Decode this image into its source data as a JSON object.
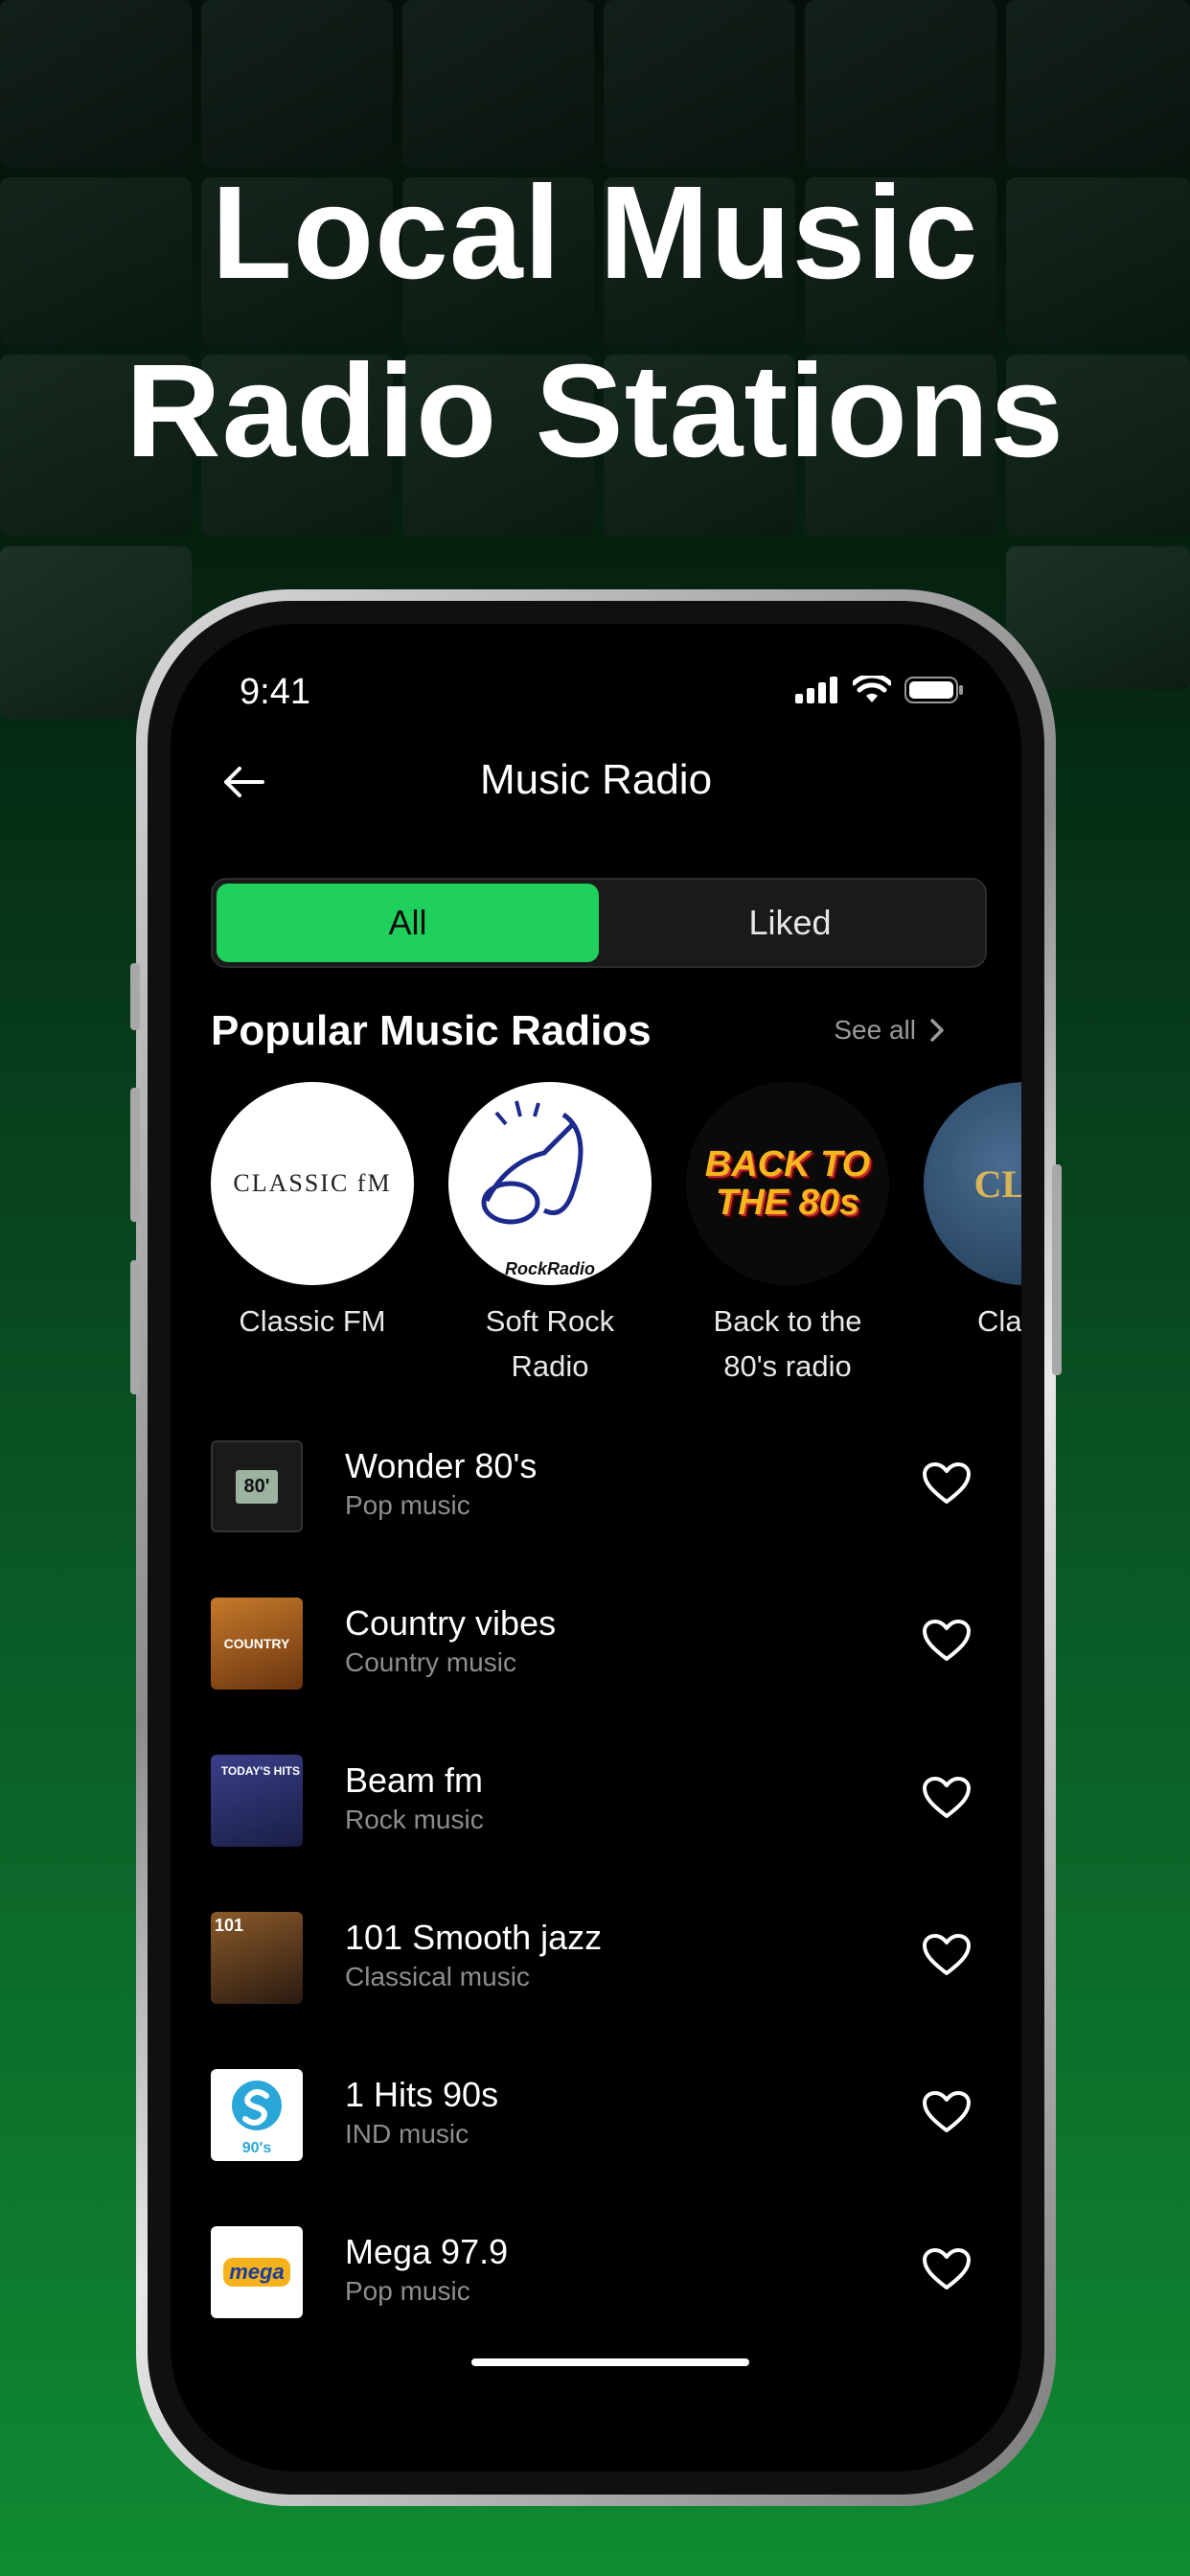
{
  "headline": {
    "line1": "Local Music",
    "line2": "Radio Stations"
  },
  "status": {
    "time": "9:41"
  },
  "nav": {
    "title": "Music Radio"
  },
  "tabs": [
    {
      "label": "All",
      "active": true
    },
    {
      "label": "Liked",
      "active": false
    }
  ],
  "popular": {
    "title": "Popular Music Radios",
    "see_all": "See all",
    "items": [
      {
        "label": "Classic FM",
        "logo_text": "CLASSIC fM"
      },
      {
        "label": "Soft Rock Radio",
        "logo_text": "RockRadio"
      },
      {
        "label": "Back to the 80's radio",
        "logo_text": "BACK TO THE 80s"
      },
      {
        "label": "Classic",
        "logo_text": "CLAS"
      }
    ]
  },
  "stations": [
    {
      "title": "Wonder 80's",
      "genre": "Pop music",
      "thumb_text": "80'"
    },
    {
      "title": "Country vibes",
      "genre": "Country music",
      "thumb_text": "COUNTRY"
    },
    {
      "title": "Beam fm",
      "genre": "Rock music",
      "thumb_text": "TODAY'S HITS"
    },
    {
      "title": "101 Smooth jazz",
      "genre": "Classical music",
      "thumb_text": "101"
    },
    {
      "title": "1 Hits 90s",
      "genre": "IND music",
      "thumb_text": "90's"
    },
    {
      "title": "Mega 97.9",
      "genre": "Pop music",
      "thumb_text": "mega"
    }
  ],
  "colors": {
    "accent": "#1fd15c",
    "background_bottom": "#0f8a32"
  }
}
